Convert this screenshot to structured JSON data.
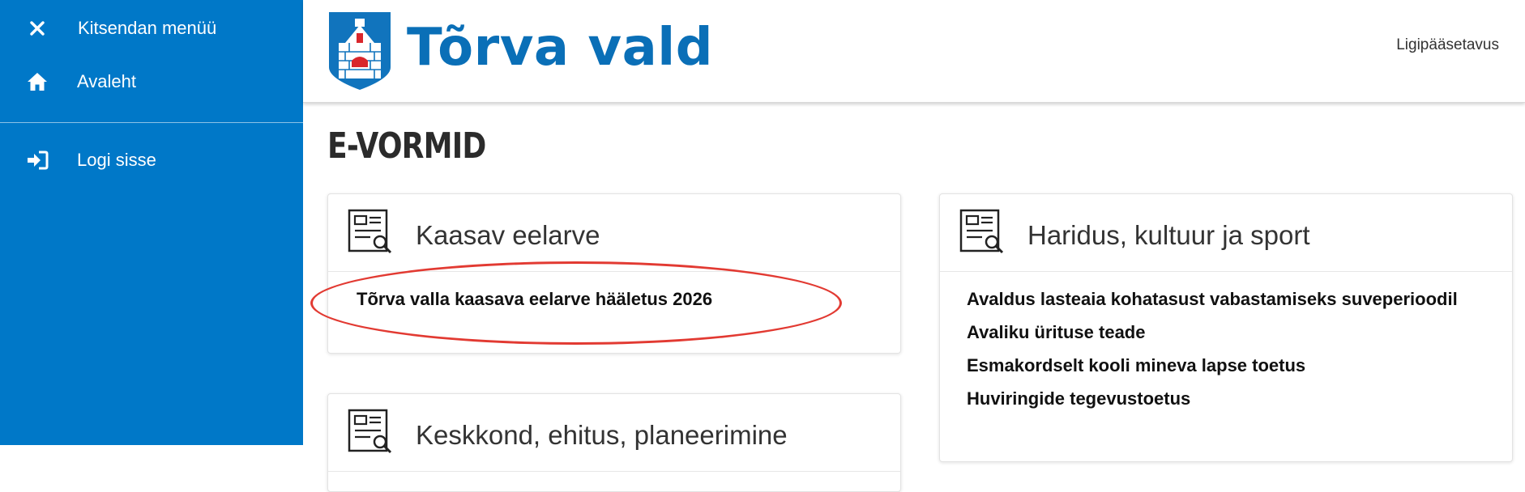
{
  "sidebar": {
    "close_label": "Kitsendan menüü",
    "items": [
      {
        "label": "Avaleht",
        "icon": "home-icon"
      },
      {
        "label": "Logi sisse",
        "icon": "sign-in-icon"
      }
    ]
  },
  "header": {
    "brand": "Tõrva vald",
    "accessibility_link": "Ligipääsetavus"
  },
  "page": {
    "title": "E-VORMID"
  },
  "cards": [
    {
      "title": "Kaasav eelarve",
      "links": [
        "Tõrva valla kaasava eelarve hääletus 2026"
      ]
    },
    {
      "title": "Haridus, kultuur ja sport",
      "links": [
        "Avaldus lasteaia kohatasust vabastamiseks suveperioodil",
        "Avaliku ürituse teade",
        "Esmakordselt kooli mineva lapse toetus",
        "Huviringide tegevustoetus"
      ]
    },
    {
      "title": "Keskkond, ehitus, planeerimine",
      "links": []
    }
  ],
  "colors": {
    "sidebar": "#0078c8",
    "brand": "#0a6fb7",
    "annotation": "#e23a32"
  }
}
